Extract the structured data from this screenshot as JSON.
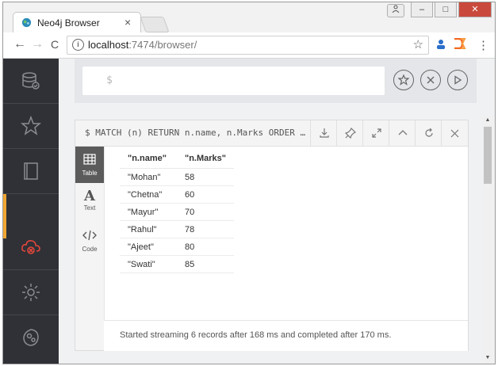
{
  "browser": {
    "tab_title": "Neo4j Browser",
    "tab_close": "×",
    "window_minimize": "–",
    "window_maximize": "□",
    "window_close": "✕",
    "url_host": "localhost",
    "url_rest": ":7474/browser/",
    "back": "←",
    "forward": "→",
    "reload": "C",
    "menu": "⋮",
    "bookmark": "☆"
  },
  "editor": {
    "prompt": "$"
  },
  "frame": {
    "command": "$ MATCH (n) RETURN n.name, n.Marks ORDER …",
    "tabs": [
      {
        "label": "Table",
        "icon": "table-icon"
      },
      {
        "label": "Text",
        "icon": "text-icon"
      },
      {
        "label": "Code",
        "icon": "code-icon"
      }
    ],
    "columns": [
      "\"n.name\"",
      "\"n.Marks\""
    ],
    "rows": [
      [
        "\"Mohan\"",
        "58"
      ],
      [
        "\"Chetna\"",
        "60"
      ],
      [
        "\"Mayur\"",
        "70"
      ],
      [
        "\"Rahul\"",
        "78"
      ],
      [
        "\"Ajeet\"",
        "80"
      ],
      [
        "\"Swati\"",
        "85"
      ]
    ],
    "footer": "Started streaming 6 records after 168 ms and completed after 170 ms."
  },
  "colors": {
    "sidebar": "#2f3136",
    "accent_orange": "#f0a732",
    "accent_red": "#e0463c"
  }
}
